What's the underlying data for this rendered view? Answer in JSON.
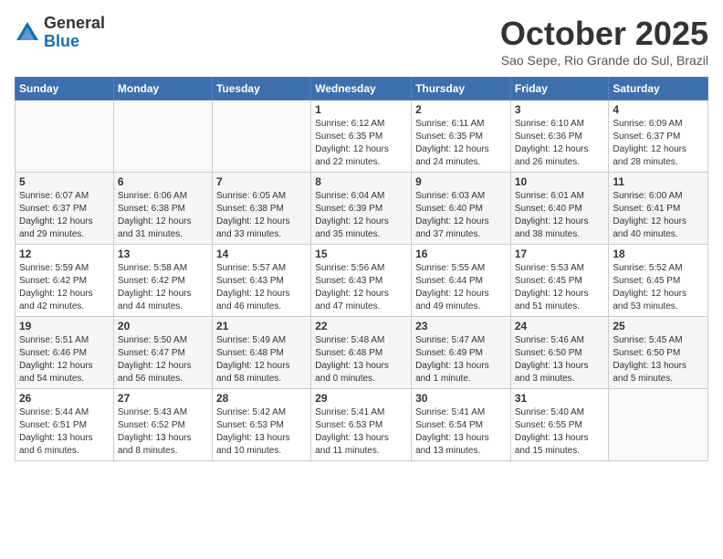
{
  "header": {
    "logo": {
      "general": "General",
      "blue": "Blue"
    },
    "title": "October 2025",
    "location": "Sao Sepe, Rio Grande do Sul, Brazil"
  },
  "weekdays": [
    "Sunday",
    "Monday",
    "Tuesday",
    "Wednesday",
    "Thursday",
    "Friday",
    "Saturday"
  ],
  "weeks": [
    [
      {
        "day": "",
        "content": ""
      },
      {
        "day": "",
        "content": ""
      },
      {
        "day": "",
        "content": ""
      },
      {
        "day": "1",
        "content": "Sunrise: 6:12 AM\nSunset: 6:35 PM\nDaylight: 12 hours\nand 22 minutes."
      },
      {
        "day": "2",
        "content": "Sunrise: 6:11 AM\nSunset: 6:35 PM\nDaylight: 12 hours\nand 24 minutes."
      },
      {
        "day": "3",
        "content": "Sunrise: 6:10 AM\nSunset: 6:36 PM\nDaylight: 12 hours\nand 26 minutes."
      },
      {
        "day": "4",
        "content": "Sunrise: 6:09 AM\nSunset: 6:37 PM\nDaylight: 12 hours\nand 28 minutes."
      }
    ],
    [
      {
        "day": "5",
        "content": "Sunrise: 6:07 AM\nSunset: 6:37 PM\nDaylight: 12 hours\nand 29 minutes."
      },
      {
        "day": "6",
        "content": "Sunrise: 6:06 AM\nSunset: 6:38 PM\nDaylight: 12 hours\nand 31 minutes."
      },
      {
        "day": "7",
        "content": "Sunrise: 6:05 AM\nSunset: 6:38 PM\nDaylight: 12 hours\nand 33 minutes."
      },
      {
        "day": "8",
        "content": "Sunrise: 6:04 AM\nSunset: 6:39 PM\nDaylight: 12 hours\nand 35 minutes."
      },
      {
        "day": "9",
        "content": "Sunrise: 6:03 AM\nSunset: 6:40 PM\nDaylight: 12 hours\nand 37 minutes."
      },
      {
        "day": "10",
        "content": "Sunrise: 6:01 AM\nSunset: 6:40 PM\nDaylight: 12 hours\nand 38 minutes."
      },
      {
        "day": "11",
        "content": "Sunrise: 6:00 AM\nSunset: 6:41 PM\nDaylight: 12 hours\nand 40 minutes."
      }
    ],
    [
      {
        "day": "12",
        "content": "Sunrise: 5:59 AM\nSunset: 6:42 PM\nDaylight: 12 hours\nand 42 minutes."
      },
      {
        "day": "13",
        "content": "Sunrise: 5:58 AM\nSunset: 6:42 PM\nDaylight: 12 hours\nand 44 minutes."
      },
      {
        "day": "14",
        "content": "Sunrise: 5:57 AM\nSunset: 6:43 PM\nDaylight: 12 hours\nand 46 minutes."
      },
      {
        "day": "15",
        "content": "Sunrise: 5:56 AM\nSunset: 6:43 PM\nDaylight: 12 hours\nand 47 minutes."
      },
      {
        "day": "16",
        "content": "Sunrise: 5:55 AM\nSunset: 6:44 PM\nDaylight: 12 hours\nand 49 minutes."
      },
      {
        "day": "17",
        "content": "Sunrise: 5:53 AM\nSunset: 6:45 PM\nDaylight: 12 hours\nand 51 minutes."
      },
      {
        "day": "18",
        "content": "Sunrise: 5:52 AM\nSunset: 6:45 PM\nDaylight: 12 hours\nand 53 minutes."
      }
    ],
    [
      {
        "day": "19",
        "content": "Sunrise: 5:51 AM\nSunset: 6:46 PM\nDaylight: 12 hours\nand 54 minutes."
      },
      {
        "day": "20",
        "content": "Sunrise: 5:50 AM\nSunset: 6:47 PM\nDaylight: 12 hours\nand 56 minutes."
      },
      {
        "day": "21",
        "content": "Sunrise: 5:49 AM\nSunset: 6:48 PM\nDaylight: 12 hours\nand 58 minutes."
      },
      {
        "day": "22",
        "content": "Sunrise: 5:48 AM\nSunset: 6:48 PM\nDaylight: 13 hours\nand 0 minutes."
      },
      {
        "day": "23",
        "content": "Sunrise: 5:47 AM\nSunset: 6:49 PM\nDaylight: 13 hours\nand 1 minute."
      },
      {
        "day": "24",
        "content": "Sunrise: 5:46 AM\nSunset: 6:50 PM\nDaylight: 13 hours\nand 3 minutes."
      },
      {
        "day": "25",
        "content": "Sunrise: 5:45 AM\nSunset: 6:50 PM\nDaylight: 13 hours\nand 5 minutes."
      }
    ],
    [
      {
        "day": "26",
        "content": "Sunrise: 5:44 AM\nSunset: 6:51 PM\nDaylight: 13 hours\nand 6 minutes."
      },
      {
        "day": "27",
        "content": "Sunrise: 5:43 AM\nSunset: 6:52 PM\nDaylight: 13 hours\nand 8 minutes."
      },
      {
        "day": "28",
        "content": "Sunrise: 5:42 AM\nSunset: 6:53 PM\nDaylight: 13 hours\nand 10 minutes."
      },
      {
        "day": "29",
        "content": "Sunrise: 5:41 AM\nSunset: 6:53 PM\nDaylight: 13 hours\nand 11 minutes."
      },
      {
        "day": "30",
        "content": "Sunrise: 5:41 AM\nSunset: 6:54 PM\nDaylight: 13 hours\nand 13 minutes."
      },
      {
        "day": "31",
        "content": "Sunrise: 5:40 AM\nSunset: 6:55 PM\nDaylight: 13 hours\nand 15 minutes."
      },
      {
        "day": "",
        "content": ""
      }
    ]
  ]
}
